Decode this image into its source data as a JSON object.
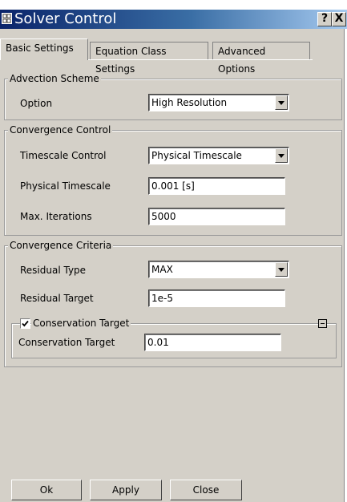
{
  "window": {
    "title": "Solver Control",
    "help_label": "?",
    "close_label": "X"
  },
  "tabs": [
    {
      "label": "Basic Settings"
    },
    {
      "label": "Equation Class Settings"
    },
    {
      "label": "Advanced Options"
    }
  ],
  "advection": {
    "group_title": "Advection Scheme",
    "option_label": "Option",
    "option_value": "High Resolution"
  },
  "convergence_control": {
    "group_title": "Convergence Control",
    "timescale_control_label": "Timescale Control",
    "timescale_control_value": "Physical Timescale",
    "physical_timescale_label": "Physical Timescale",
    "physical_timescale_value": "0.001 [s]",
    "max_iterations_label": "Max. Iterations",
    "max_iterations_value": "5000"
  },
  "convergence_criteria": {
    "group_title": "Convergence Criteria",
    "residual_type_label": "Residual Type",
    "residual_type_value": "MAX",
    "residual_target_label": "Residual Target",
    "residual_target_value": "1e-5",
    "conservation_group_title": "Conservation Target",
    "conservation_checked": true,
    "conservation_target_label": "Conservation Target",
    "conservation_target_value": "0.01"
  },
  "buttons": {
    "ok": "Ok",
    "apply": "Apply",
    "close": "Close"
  },
  "colors": {
    "title_start": "#0a246a",
    "title_end": "#a6caf0",
    "dialog_bg": "#d4d0c8"
  }
}
